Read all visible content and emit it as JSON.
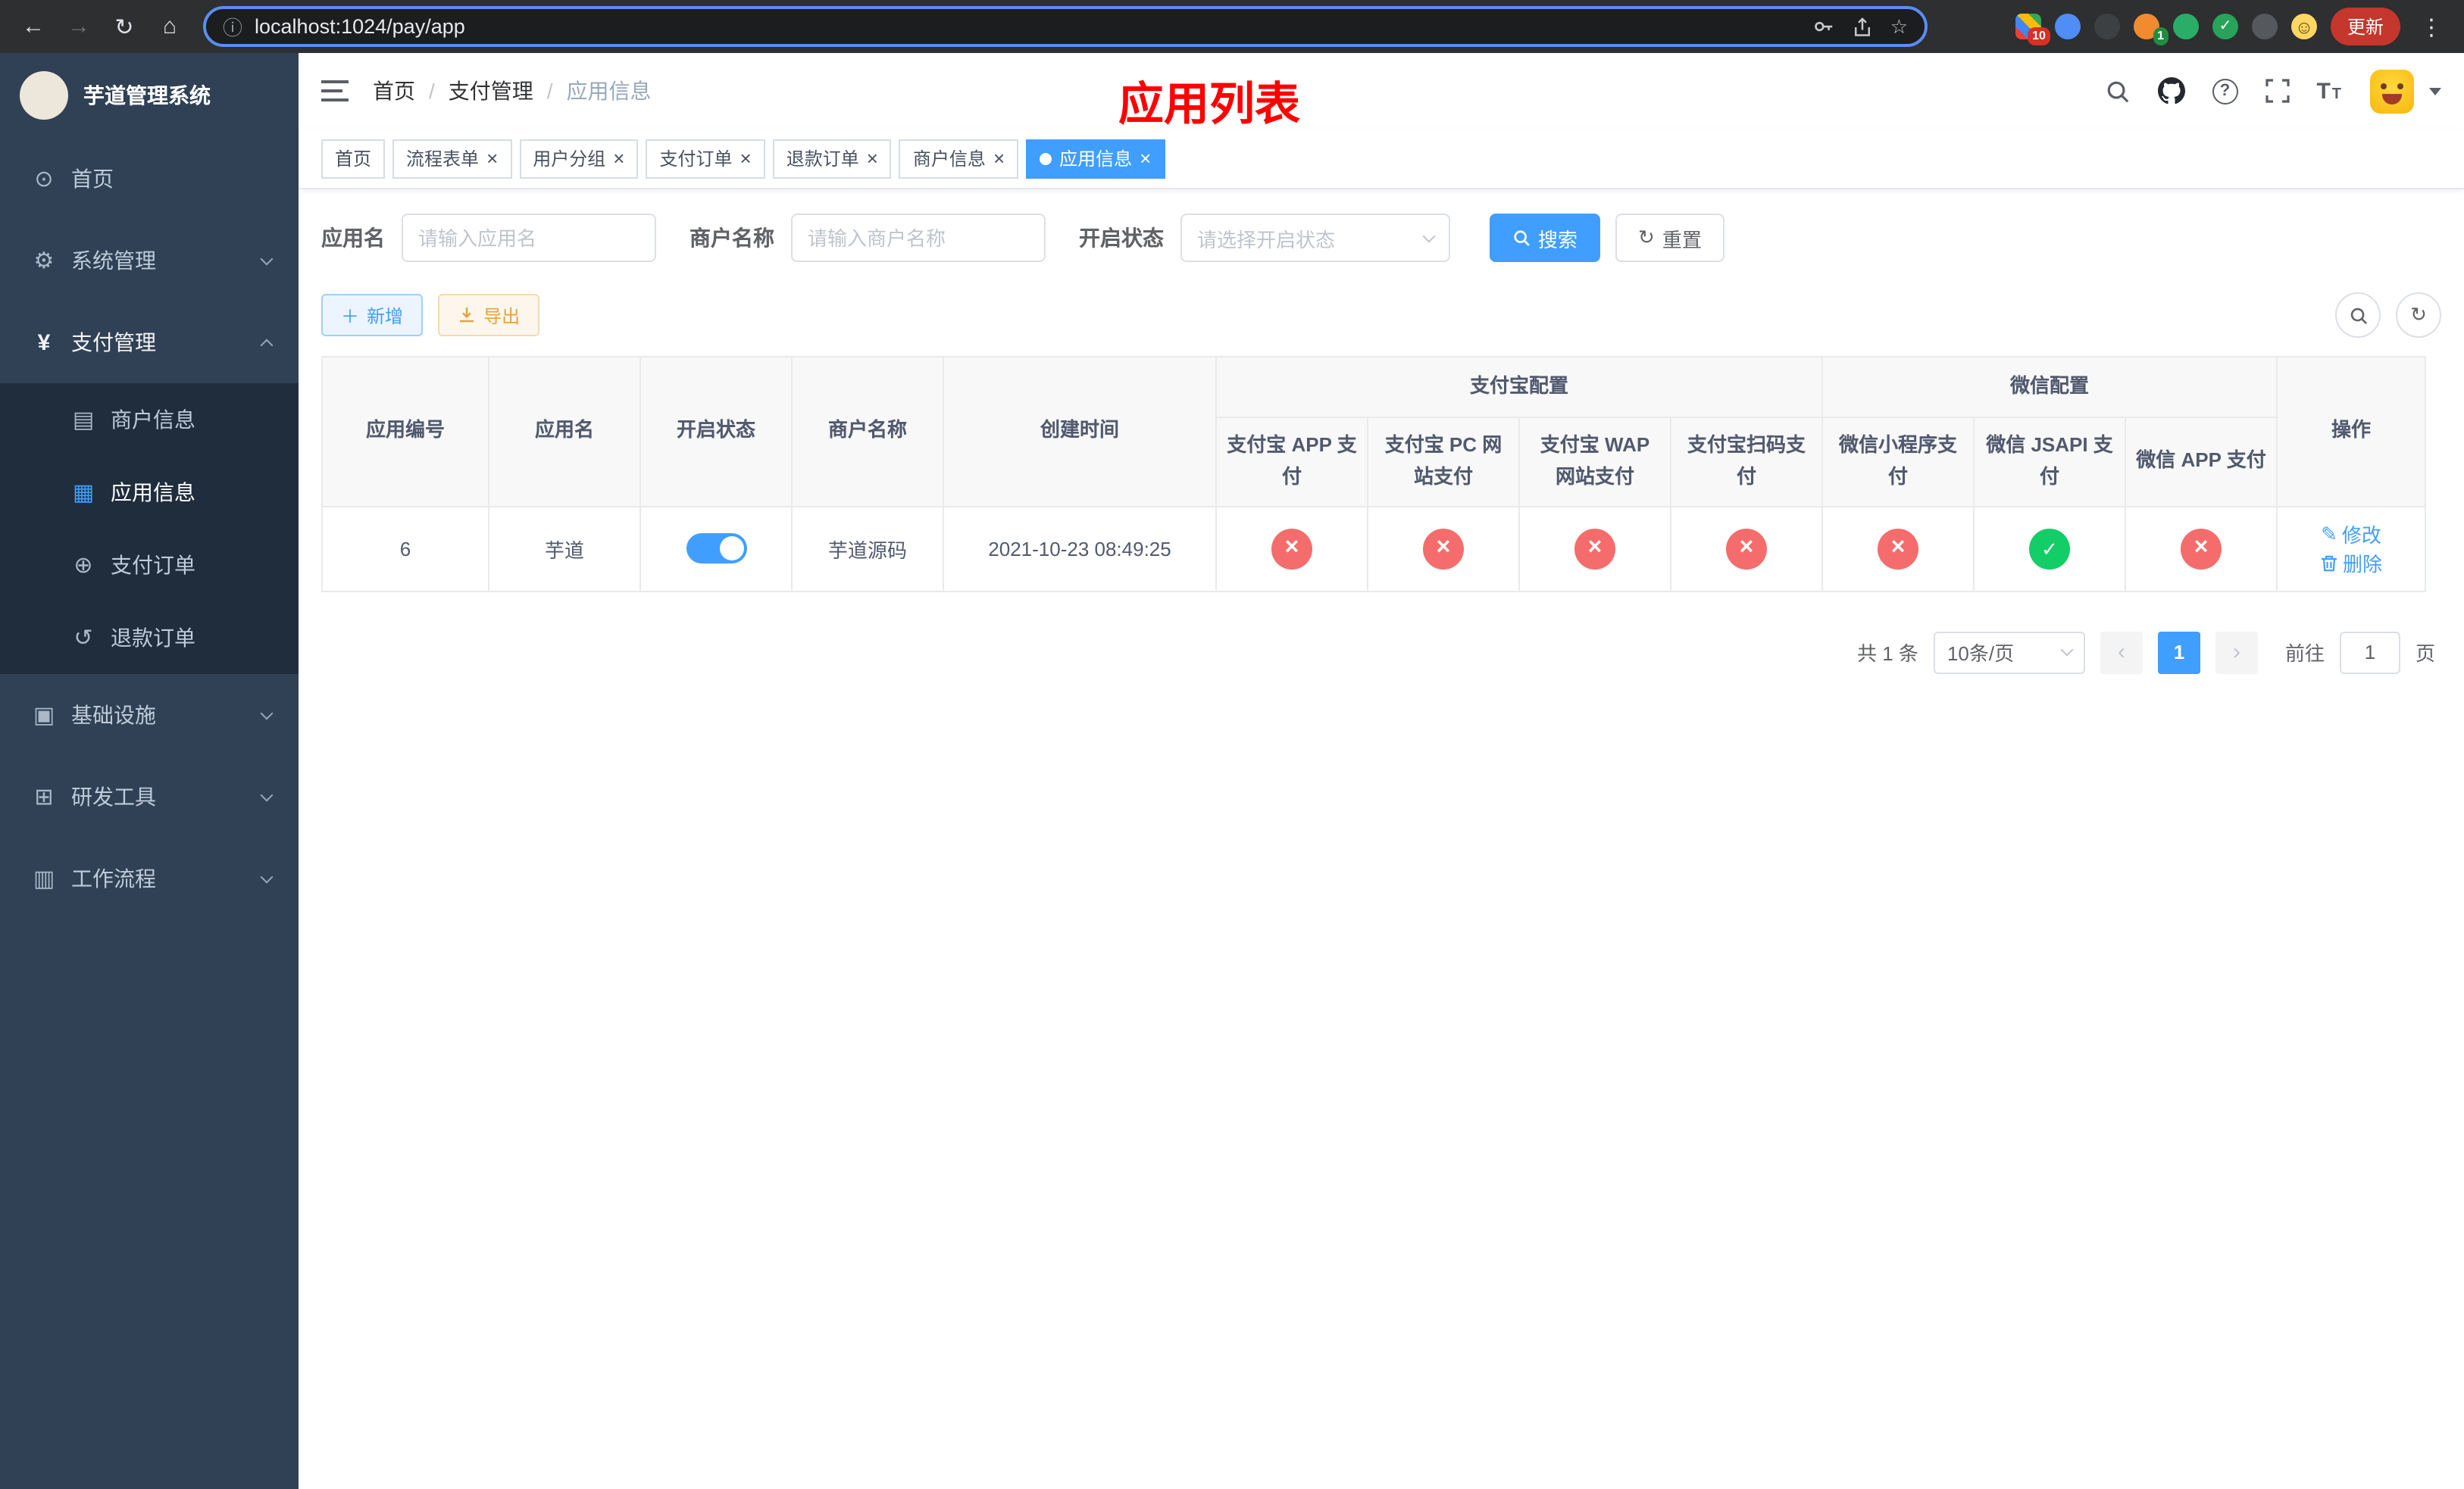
{
  "browser": {
    "url": "localhost:1024/pay/app",
    "update_button": "更新",
    "extensions_badge": "10",
    "profile_badge": "1"
  },
  "sidebar": {
    "app_title": "芋道管理系统",
    "items": [
      {
        "label": "首页"
      },
      {
        "label": "系统管理"
      },
      {
        "label": "支付管理"
      },
      {
        "label": "商户信息"
      },
      {
        "label": "应用信息"
      },
      {
        "label": "支付订单"
      },
      {
        "label": "退款订单"
      },
      {
        "label": "基础设施"
      },
      {
        "label": "研发工具"
      },
      {
        "label": "工作流程"
      }
    ]
  },
  "navbar": {
    "breadcrumb": {
      "home": "首页",
      "section": "支付管理",
      "current": "应用信息"
    },
    "annotation": "应用列表"
  },
  "tabs": [
    {
      "label": "首页"
    },
    {
      "label": "流程表单"
    },
    {
      "label": "用户分组"
    },
    {
      "label": "支付订单"
    },
    {
      "label": "退款订单"
    },
    {
      "label": "商户信息"
    },
    {
      "label": "应用信息"
    }
  ],
  "filters": {
    "app_name_label": "应用名",
    "app_name_placeholder": "请输入应用名",
    "merchant_label": "商户名称",
    "merchant_placeholder": "请输入商户名称",
    "status_label": "开启状态",
    "status_placeholder": "请选择开启状态",
    "search_button": "搜索",
    "reset_button": "重置"
  },
  "toolbar": {
    "add_button": "新增",
    "export_button": "导出"
  },
  "table": {
    "headers": {
      "app_id": "应用编号",
      "app_name": "应用名",
      "status": "开启状态",
      "merchant_name": "商户名称",
      "create_time": "创建时间",
      "alipay_group": "支付宝配置",
      "wechat_group": "微信配置",
      "alipay_app": "支付宝 APP 支付",
      "alipay_pc": "支付宝 PC 网站支付",
      "alipay_wap": "支付宝 WAP 网站支付",
      "alipay_qr": "支付宝扫码支付",
      "wx_lite": "微信小程序支付",
      "wx_jsapi": "微信 JSAPI 支付",
      "wx_app": "微信 APP 支付",
      "actions": "操作"
    },
    "rows": [
      {
        "app_id": "6",
        "app_name": "芋道",
        "status": "on",
        "merchant_name": "芋道源码",
        "create_time": "2021-10-23 08:49:25",
        "configs": {
          "alipay_app": "cross",
          "alipay_pc": "cross",
          "alipay_wap": "cross",
          "alipay_qr": "cross",
          "wx_lite": "cross",
          "wx_jsapi": "check",
          "wx_app": "cross"
        },
        "edit_label": "修改",
        "delete_label": "删除"
      }
    ]
  },
  "pagination": {
    "total": "共 1 条",
    "page_size": "10条/页",
    "page": "1",
    "goto_label": "前往",
    "goto_value": "1",
    "goto_suffix": "页"
  },
  "colors": {
    "primary": "#409eff",
    "success": "#13ce66",
    "danger": "#f56c6c",
    "warning": "#e6a23c",
    "sidebar_bg": "#304156",
    "submenu_bg": "#1f2d3d",
    "annotation": "#ff0000"
  }
}
